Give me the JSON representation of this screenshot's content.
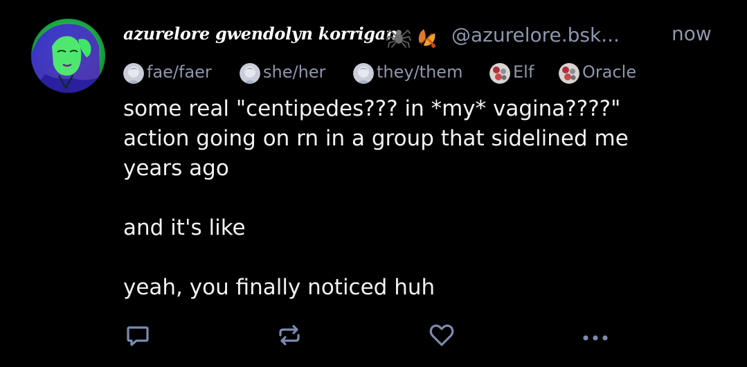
{
  "post": {
    "author": {
      "display_name": "azurelore gwendolyn korrigan",
      "name_emojis": [
        "spider-emoji",
        "autumn-leaves-emoji"
      ],
      "handle": "@azurelore.bsk...",
      "avatar": "avatar-image"
    },
    "timestamp": "now",
    "labels": [
      {
        "text": "fae/faer",
        "icon": "pronoun-label-icon"
      },
      {
        "text": "she/her",
        "icon": "pronoun-label-icon"
      },
      {
        "text": "they/them",
        "icon": "pronoun-label-icon"
      },
      {
        "text": "Elf",
        "icon": "floral-label-icon"
      },
      {
        "text": "Oracle",
        "icon": "floral-label-icon"
      }
    ],
    "text": "some real \"centipedes??? in *my* vagina????\"\naction going on rn in a group that sidelined me\nyears ago\n\nand it's like\n\nyeah, you finally noticed huh",
    "actions": [
      "reply",
      "repost",
      "like",
      "more"
    ]
  },
  "colors": {
    "background": "#000000",
    "text_primary": "#f1f3f5",
    "text_secondary": "#8e97ad",
    "icon": "#7b8bb0",
    "avatar_accent": "#22e05a"
  }
}
